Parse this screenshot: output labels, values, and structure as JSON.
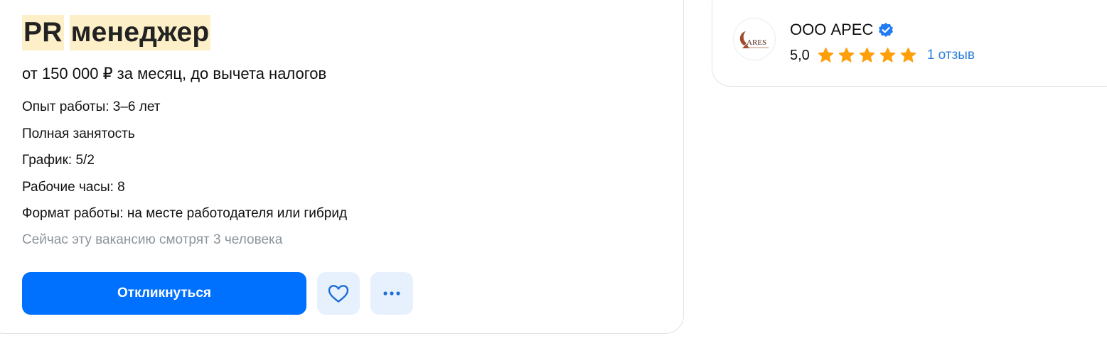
{
  "vacancy": {
    "title_words": [
      "PR",
      "менеджер"
    ],
    "salary": "от 150 000 ₽ за месяц, до вычета налогов",
    "facts": [
      "Опыт работы: 3–6 лет",
      "Полная занятость",
      "График: 5/2",
      "Рабочие часы: 8",
      "Формат работы: на месте работодателя или гибрид"
    ],
    "viewers": "Сейчас эту вакансию смотрят 3 человека",
    "apply_label": "Откликнуться",
    "favorite_icon": "heart-icon",
    "more_icon": "more-dots-icon"
  },
  "employer": {
    "logo_text": "ARES",
    "name": "ООО АРЕС",
    "verified_icon": "verified-check-icon",
    "rating": "5,0",
    "stars": 5,
    "reviews": "1 отзыв"
  },
  "colors": {
    "accent": "#0070ff",
    "title_highlight": "#fdefc7",
    "secondary_button_bg": "#e6f1fd",
    "star": "#ff9f0a",
    "link": "#2b7fd8",
    "muted_text": "#8c949c",
    "verified": "#1f7cf5"
  }
}
